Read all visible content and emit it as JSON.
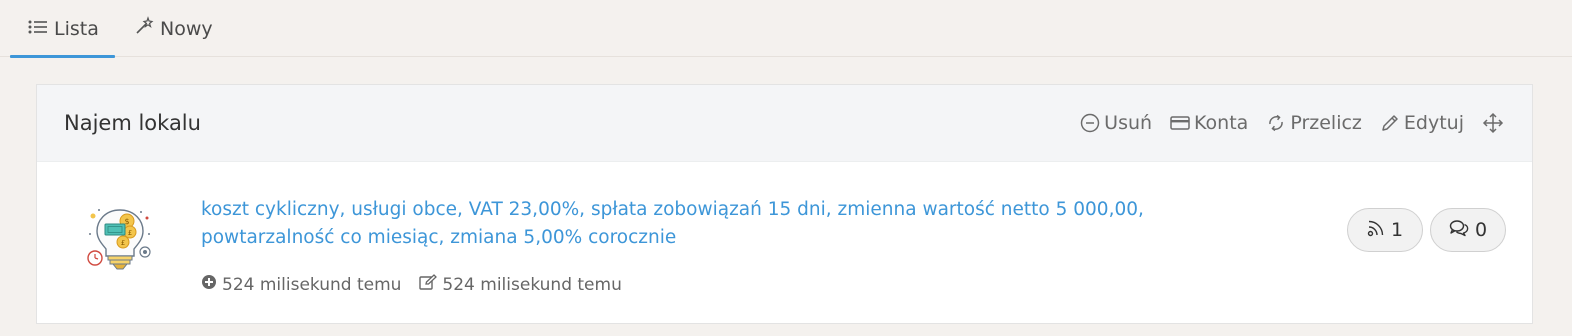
{
  "tabs": [
    {
      "label": "Lista",
      "icon": "list-icon",
      "active": true
    },
    {
      "label": "Nowy",
      "icon": "magic-wand-icon",
      "active": false
    }
  ],
  "card": {
    "title": "Najem lokalu",
    "actions": [
      {
        "label": "Usuń",
        "icon": "minus-circle-icon"
      },
      {
        "label": "Konta",
        "icon": "credit-card-icon"
      },
      {
        "label": "Przelicz",
        "icon": "refresh-icon"
      },
      {
        "label": "Edytuj",
        "icon": "pencil-icon"
      },
      {
        "label": "",
        "icon": "move-icon"
      }
    ],
    "item": {
      "description": "koszt cykliczny, usługi obce, VAT 23,00%, spłata zobowiązań 15 dni, zmienna wartość netto 5 000,00, powtarzalność co miesiąc, zmiana 5,00% corocznie",
      "created": "524 milisekund temu",
      "modified": "524 milisekund temu",
      "rss_count": "1",
      "comments_count": "0",
      "thumbnail_icon": "idea-bulb-money-icon"
    }
  },
  "colors": {
    "accent": "#3d96d8",
    "background": "#f4f1ee",
    "header": "#f4f5f7"
  }
}
